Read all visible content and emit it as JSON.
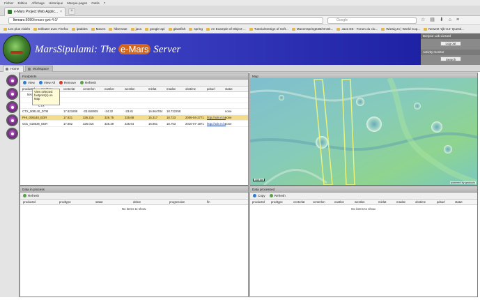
{
  "browser": {
    "menu": [
      "Fichier",
      "Édition",
      "Affichage",
      "Historique",
      "Marque-pages",
      "Outils",
      "?"
    ],
    "tab_title": "e-Mars Project Web Applic...",
    "tab_close": "×",
    "new_tab": "+",
    "url_host": "ltemars",
    "url_rest": ":8080/emars-gwt-4.0/",
    "search_placeholder": "Google",
    "bookmarks": [
      "Les plus visités",
      "Débuter avec Firefox",
      "iptables",
      "Maven",
      "hibernate",
      "java",
      "google-api",
      "glassfish",
      "spring",
      "An Example of Object-...",
      "Tutorial:Design of Soft...",
      "MavenSpringEJB/OnGit...",
      "Java EE - Forum du clu...",
      "Wizwig.tn | World Cup...",
      "Newest 'ejb-3.2' Questi..."
    ]
  },
  "header": {
    "title_prefix": "MarsSipulami",
    "title_mid": ": The ",
    "title_badge": "e-Mars",
    "title_suffix": " Server"
  },
  "userbox": {
    "welcome": "Bonjour Lab Lizzard",
    "logout": "Log out",
    "activity": "Activity monitor",
    "search_label": "Search"
  },
  "app_tabs": [
    "Home",
    "Workspace"
  ],
  "footprints": {
    "title": "Footprints",
    "toolbar": [
      "View",
      "View All",
      "Remove",
      "Refresh"
    ],
    "tooltip": "View selected footprint(s) on Map",
    "columns": [
      "productId",
      "prodtype",
      "centerlat",
      "centerlon",
      "eastlon",
      "westlon",
      "minlat",
      "maxlat",
      "obstime",
      "pdsurl",
      "statut"
    ],
    "tree": [
      "MARS",
      "MRO",
      "CTX"
    ],
    "rows": [
      {
        "productId": "CTX_008140_DTM",
        "centerlat": "17.821809",
        "centerlon": "-33.848935",
        "eastlon": "-34.32",
        "westlon": "-33.81",
        "minlat": "16.864784",
        "maxlat": "18.722258",
        "obstime": "",
        "pdsurl": "",
        "statut": "none"
      },
      {
        "productId": "PHI_008140_EDR",
        "centerlat": "17.821",
        "centerlon": "326.215",
        "eastlon": "326.75",
        "westlon": "325.68",
        "minlat": "15.317",
        "maxlat": "18.723",
        "obstime": "2006-04-2771",
        "pdsurl": "http://ode.rsl.v",
        "statut": "none"
      },
      {
        "productId": "G01_018636_EDR",
        "centerlat": "17.802",
        "centerlon": "326.015",
        "eastlon": "326.39",
        "westlon": "325.64",
        "minlat": "16.851",
        "maxlat": "18.753",
        "obstime": "2010-07-1871",
        "pdsurl": "http://ode.rsl.v",
        "statut": "none"
      }
    ]
  },
  "map": {
    "title": "Map",
    "scale": "100 km",
    "attribution": "powered by geotools"
  },
  "in_process": {
    "title": "Data in process",
    "toolbar": [
      "Refresh"
    ],
    "columns": [
      "productId",
      "prodtype",
      "statut",
      "debut",
      "progression",
      "fin"
    ],
    "empty": "No items to show."
  },
  "processed": {
    "title": "Data processed",
    "toolbar": [
      "Copy",
      "Refresh"
    ],
    "columns": [
      "productId",
      "prodtype",
      "centerlat",
      "centerlon",
      "eastlon",
      "westlon",
      "minlat",
      "maxlat",
      "obstime",
      "pdsurl",
      "statut"
    ],
    "empty": "No items to show."
  },
  "colors": {
    "header_dark": "#1e21a4",
    "selection": "#f3dd8a",
    "accent": "#d4661e"
  }
}
